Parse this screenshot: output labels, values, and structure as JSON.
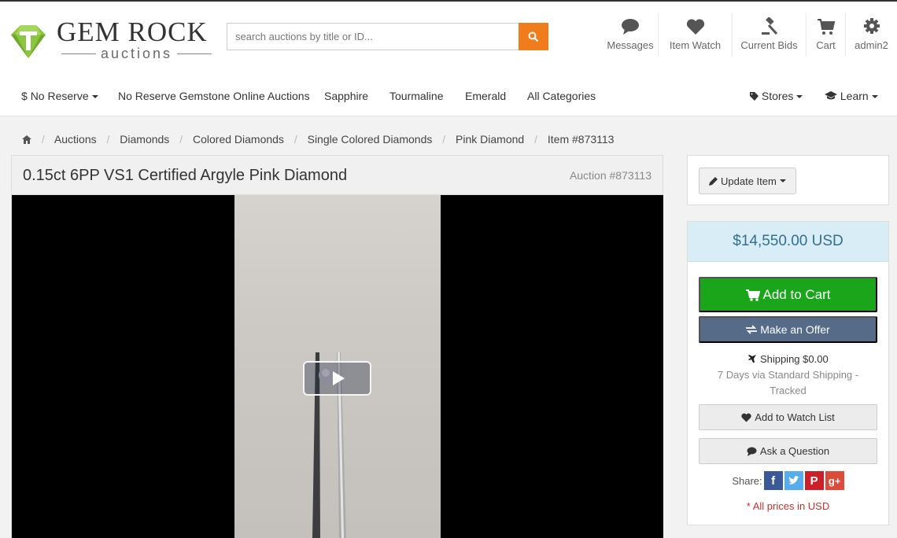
{
  "brand": {
    "name": "GEM ROCK",
    "sub": "auctions"
  },
  "search": {
    "placeholder": "search auctions by title or ID..."
  },
  "topnav": [
    {
      "label": "Messages",
      "icon": "chat-icon"
    },
    {
      "label": "Item Watch",
      "icon": "heart-icon"
    },
    {
      "label": "Current Bids",
      "icon": "gavel-icon"
    },
    {
      "label": "Cart",
      "icon": "cart-icon"
    },
    {
      "label": "admin2",
      "icon": "gear-icon"
    }
  ],
  "mainnav": {
    "no_reserve": "No Reserve",
    "no_reserve_online": "No Reserve Gemstone Online Auctions",
    "sapphire": "Sapphire",
    "tourmaline": "Tourmaline",
    "emerald": "Emerald",
    "all_categories": "All Categories",
    "stores": "Stores",
    "learn": "Learn"
  },
  "breadcrumb": [
    "Auctions",
    "Diamonds",
    "Colored Diamonds",
    "Single Colored Diamonds",
    "Pink Diamond",
    "Item #873113"
  ],
  "item": {
    "title": "0.15ct 6PP VS1 Certified Argyle Pink Diamond",
    "auction_label": "Auction #873113"
  },
  "sidebar": {
    "update_label": "Update Item",
    "price": "$14,550.00 USD",
    "add_to_cart": "Add to Cart",
    "make_offer": "Make an Offer",
    "shipping": "Shipping $0.00",
    "shipping_detail": "7 Days via Standard Shipping - Tracked",
    "watch": "Add to Watch List",
    "ask": "Ask a Question",
    "share": "Share:",
    "note": "* All prices in USD"
  },
  "colors": {
    "accent_orange": "#f07c1c",
    "cart_green": "#1ba51b",
    "offer_slate": "#566b87",
    "price_bg": "#d9edf7",
    "price_text": "#31708f",
    "note_red": "#c9302c",
    "logo_green": "#8cc63f"
  }
}
